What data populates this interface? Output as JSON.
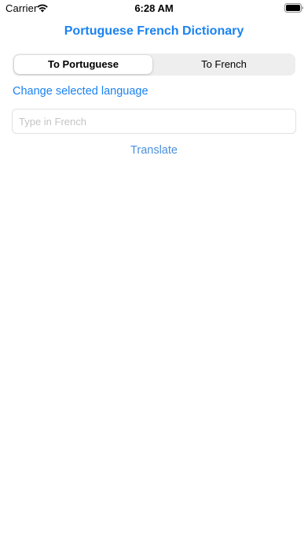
{
  "status_bar": {
    "carrier": "Carrier",
    "time": "6:28 AM",
    "wifi_icon": "wifi-icon",
    "battery_icon": "battery-full-icon"
  },
  "header": {
    "title": "Portuguese French Dictionary"
  },
  "segmented_control": {
    "options": [
      {
        "label": "To Portuguese",
        "selected": true
      },
      {
        "label": "To French",
        "selected": false
      }
    ]
  },
  "change_language_link": "Change selected language",
  "search": {
    "value": "",
    "placeholder": "Type in French"
  },
  "translate_button": "Translate",
  "colors": {
    "accent": "#1a82f0",
    "segment_background": "#eeeeef",
    "placeholder": "#c4c4c7"
  }
}
